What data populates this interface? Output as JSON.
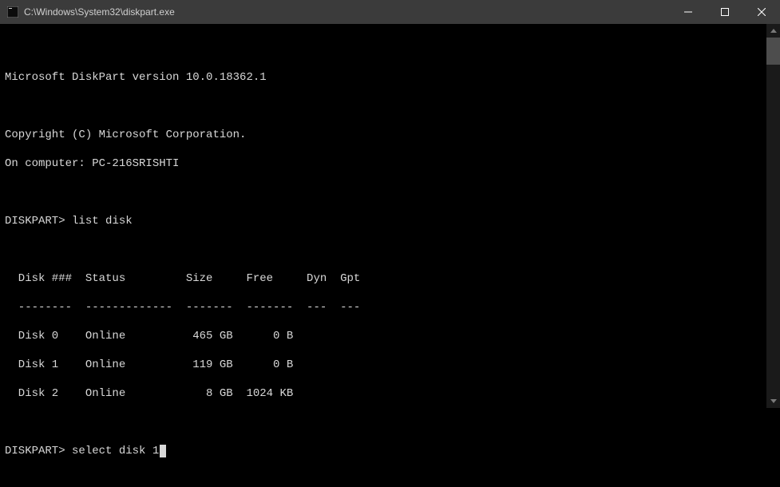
{
  "window": {
    "title": "C:\\Windows\\System32\\diskpart.exe"
  },
  "header": {
    "version_line": "Microsoft DiskPart version 10.0.18362.1",
    "copyright_line": "Copyright (C) Microsoft Corporation.",
    "computer_line": "On computer: PC-216SRISHTI"
  },
  "prompt": "DISKPART>",
  "commands": {
    "first": "list disk",
    "second": "select disk 1"
  },
  "table": {
    "header": "  Disk ###  Status         Size     Free     Dyn  Gpt",
    "divider": "  --------  -------------  -------  -------  ---  ---",
    "rows": [
      "  Disk 0    Online          465 GB      0 B",
      "  Disk 1    Online          119 GB      0 B",
      "  Disk 2    Online            8 GB  1024 KB"
    ]
  },
  "disk_data": [
    {
      "id": "Disk 0",
      "status": "Online",
      "size": "465 GB",
      "free": "0 B",
      "dyn": "",
      "gpt": ""
    },
    {
      "id": "Disk 1",
      "status": "Online",
      "size": "119 GB",
      "free": "0 B",
      "dyn": "",
      "gpt": ""
    },
    {
      "id": "Disk 2",
      "status": "Online",
      "size": "8 GB",
      "free": "1024 KB",
      "dyn": "",
      "gpt": ""
    }
  ]
}
